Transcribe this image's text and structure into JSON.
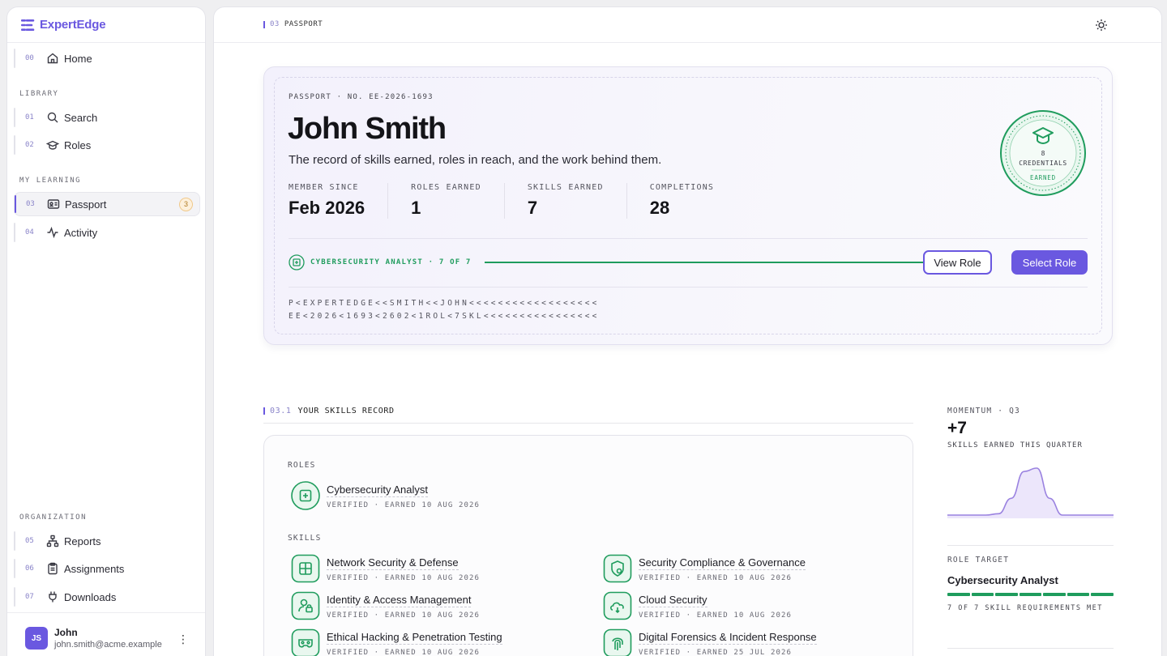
{
  "brand": {
    "name": "ExpertEdge",
    "accent": "#6a58e0"
  },
  "sidebar": {
    "home": {
      "num": "00",
      "label": "Home"
    },
    "library_label": "LIBRARY",
    "search": {
      "num": "01",
      "label": "Search"
    },
    "roles": {
      "num": "02",
      "label": "Roles"
    },
    "my_learning_label": "MY LEARNING",
    "passport": {
      "num": "03",
      "label": "Passport",
      "badge": "3"
    },
    "activity": {
      "num": "04",
      "label": "Activity"
    },
    "organization_label": "ORGANIZATION",
    "reports": {
      "num": "05",
      "label": "Reports"
    },
    "assignments": {
      "num": "06",
      "label": "Assignments"
    },
    "downloads": {
      "num": "07",
      "label": "Downloads"
    }
  },
  "user": {
    "initials": "JS",
    "name": "John",
    "email": "john.smith@acme.example"
  },
  "topbar": {
    "crumb_num": "03",
    "crumb_label": "PASSPORT"
  },
  "passport": {
    "eyebrow": "PASSPORT · NO. EE-2026-1693",
    "name": "John Smith",
    "subtitle": "The record of skills earned, roles in reach, and the work behind them.",
    "stats": [
      {
        "label": "MEMBER SINCE",
        "value": "Feb 2026"
      },
      {
        "label": "ROLES EARNED",
        "value": "1"
      },
      {
        "label": "SKILLS EARNED",
        "value": "7"
      },
      {
        "label": "COMPLETIONS",
        "value": "28"
      }
    ],
    "seal": {
      "count": "8",
      "label": "CREDENTIALS",
      "status": "EARNED"
    },
    "progress": {
      "label": "CYBERSECURITY ANALYST · 7 OF 7",
      "fraction": 1.0
    },
    "view_role": "View Role",
    "select_role": "Select Role",
    "mrz_line1": "P<EXPERTEDGE<<SMITH<<JOHN<<<<<<<<<<<<<<<<<<",
    "mrz_line2": "EE<2026<1693<2602<1ROL<7SKL<<<<<<<<<<<<<<<<"
  },
  "record": {
    "section_num": "03.1",
    "section_label": "YOUR SKILLS RECORD",
    "roles_label": "ROLES",
    "role": {
      "title": "Cybersecurity Analyst",
      "meta": "VERIFIED · EARNED 10 AUG 2026"
    },
    "skills_label": "SKILLS",
    "skills": [
      {
        "title": "Network Security & Defense",
        "meta": "VERIFIED · EARNED 10 AUG 2026"
      },
      {
        "title": "Security Compliance & Governance",
        "meta": "VERIFIED · EARNED 10 AUG 2026"
      },
      {
        "title": "Identity & Access Management",
        "meta": "VERIFIED · EARNED 10 AUG 2026"
      },
      {
        "title": "Cloud Security",
        "meta": "VERIFIED · EARNED 10 AUG 2026"
      },
      {
        "title": "Ethical Hacking & Penetration Testing",
        "meta": "VERIFIED · EARNED 10 AUG 2026"
      },
      {
        "title": "Digital Forensics & Incident Response",
        "meta": "VERIFIED · EARNED 25 JUL 2026"
      }
    ]
  },
  "momentum": {
    "eyebrow": "MOMENTUM · Q3",
    "value": "+7",
    "sub": "SKILLS EARNED THIS QUARTER",
    "series": [
      0,
      0,
      0,
      0,
      0.2,
      2.5,
      6.5,
      7,
      2.5,
      0,
      0,
      0,
      0,
      0
    ]
  },
  "role_target": {
    "eyebrow": "ROLE TARGET",
    "role": "Cybersecurity Analyst",
    "met": 7,
    "total": 7,
    "met_label": "7 OF 7 SKILL REQUIREMENTS MET"
  },
  "colors": {
    "accent": "#6a58e0",
    "success": "#1f9c5d"
  }
}
